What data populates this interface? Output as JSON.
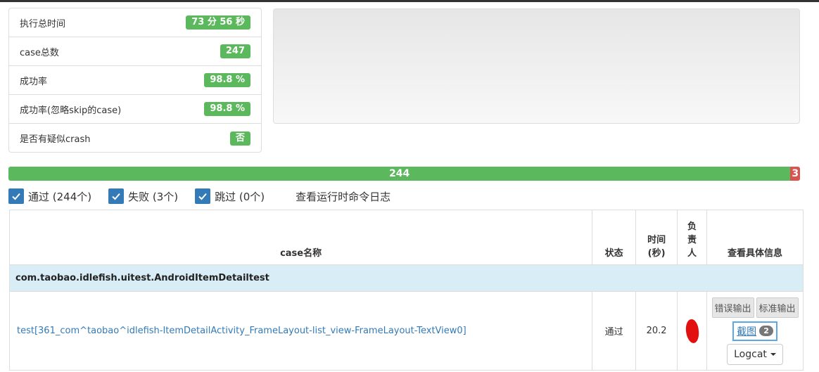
{
  "summary": {
    "rows": [
      {
        "label": "执行总时间",
        "value": "73 分 56 秒"
      },
      {
        "label": "case总数",
        "value": "247"
      },
      {
        "label": "成功率",
        "value": "98.8 %"
      },
      {
        "label": "成功率(忽略skip的case)",
        "value": "98.8 %"
      },
      {
        "label": "是否有疑似crash",
        "value": "否"
      }
    ]
  },
  "progress": {
    "passed": "244",
    "failed": "3",
    "passed_fraction": 0.9879
  },
  "filters": {
    "pass_label": "通过 (244个)",
    "fail_label": "失败 (3个)",
    "skip_label": "跳过 (0个)",
    "log_link": "查看运行时命令日志"
  },
  "table": {
    "headers": {
      "name": "case名称",
      "status": "状态",
      "time": "时间\n(秒)",
      "owner": "负\n责\n人",
      "details": "查看具体信息"
    },
    "group": "com.taobao.idlefish.uitest.AndroidItemDetailtest",
    "rows": [
      {
        "name": "test[361_com^taobao^idlefish-ItemDetailActivity_FrameLayout-list_view-FrameLayout-TextView0]",
        "status": "通过",
        "time": "20.2",
        "stderr_label": "错误输出",
        "stdout_label": "标准输出",
        "screenshot_label": "截图",
        "screenshot_count": "2",
        "logcat_label": "Logcat"
      }
    ]
  },
  "colors": {
    "success": "#5cb85c",
    "danger": "#d9534f",
    "primary": "#337ab7",
    "info_row": "#d9edf7"
  }
}
